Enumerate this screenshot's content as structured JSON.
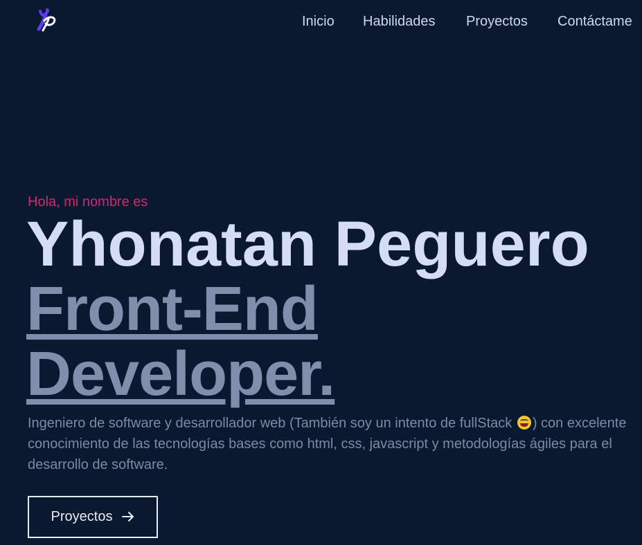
{
  "logo": {
    "icon": "yp-monogram-icon",
    "colors": [
      "#5b3df5",
      "#ffffff"
    ]
  },
  "nav": {
    "items": [
      {
        "label": "Inicio"
      },
      {
        "label": "Habilidades"
      },
      {
        "label": "Proyectos"
      },
      {
        "label": "Contáctame"
      }
    ]
  },
  "hero": {
    "greeting": "Hola, mi nombre es",
    "name": "Yhonatan Peguero",
    "role_line1": "Front-End",
    "role_line2": "Developer.",
    "description_part1": "Ingeniero de software y desarrollador web (También soy un intento de fullStack",
    "emoji": "laughing-face-icon",
    "description_part2": ") con excelente conocimiento de las tecnologías bases como html, css, javascript y metodologías ágiles para el desarrollo de software.",
    "cta_label": "Proyectos",
    "cta_icon": "arrow-right-icon"
  },
  "colors": {
    "background": "#0b1930",
    "accent": "#d6286e",
    "heading": "#d5ddf6",
    "muted": "#7f8eab"
  }
}
